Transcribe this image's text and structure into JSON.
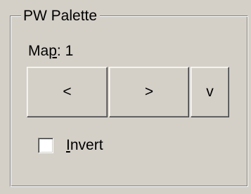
{
  "group": {
    "title": "PW Palette"
  },
  "map": {
    "label_prefix": "Ma",
    "label_accel": "p",
    "label_suffix": ":",
    "value": "1"
  },
  "buttons": {
    "prev_label": "<",
    "next_label": ">",
    "down_label": "v"
  },
  "invert": {
    "label_accel": "I",
    "label_rest": "nvert",
    "checked": false
  },
  "colors": {
    "face": "#d4d0c8",
    "highlight": "#ffffff",
    "shadow": "#808080",
    "dark_shadow": "#404040"
  }
}
